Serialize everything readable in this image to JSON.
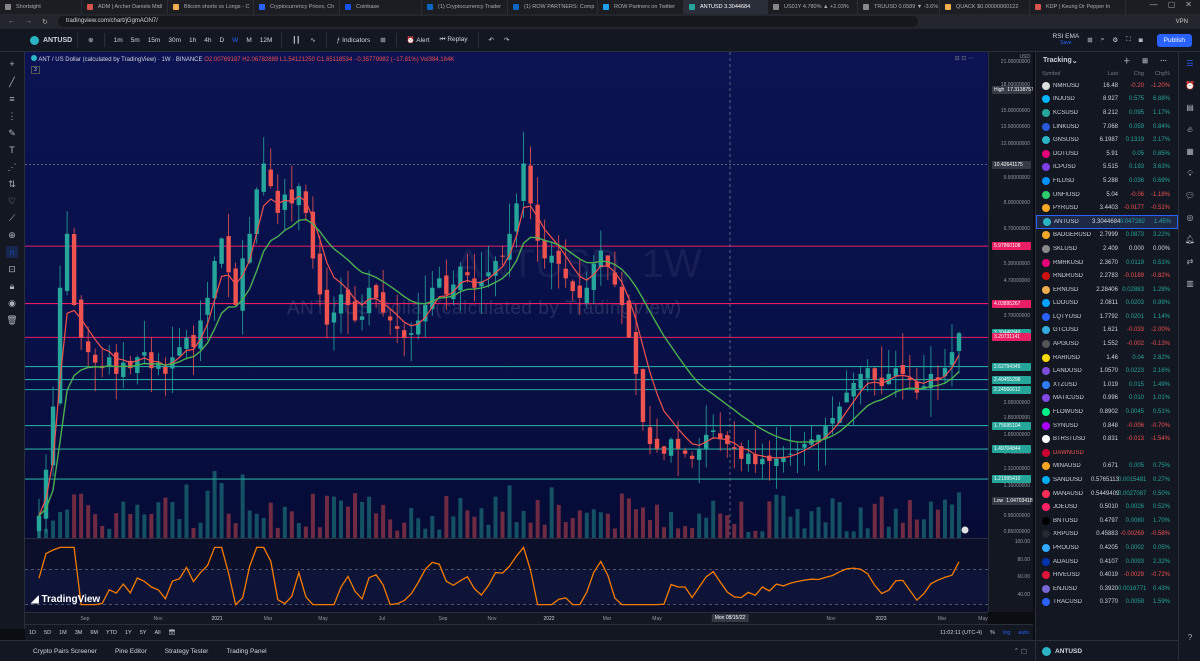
{
  "browser": {
    "tabs": [
      {
        "label": "Shortsight",
        "color": "#888"
      },
      {
        "label": "ADM | Archer Daniels Midl",
        "color": "#d9534f"
      },
      {
        "label": "Bitcoin shorts vs Longs - C",
        "color": "#f0ad4e"
      },
      {
        "label": "Cryptocurrency Prices, Ch",
        "color": "#2962ff"
      },
      {
        "label": "Coinbase",
        "color": "#1652f0"
      },
      {
        "label": "(1) Cryptocurrency Trader",
        "color": "#0a66c2"
      },
      {
        "label": "(1) ROW PARTNERS: Comp",
        "color": "#0a66c2"
      },
      {
        "label": "ROW Partners on Twitter",
        "color": "#1da1f2"
      },
      {
        "label": "ANTUSD 3.3044684",
        "color": "#26a69a",
        "active": true
      },
      {
        "label": "US01Y 4.780% ▲ +2.03%",
        "color": "#888"
      },
      {
        "label": "TRUUSD 0.0589 ▼ -3.6%",
        "color": "#888"
      },
      {
        "label": "QUACK $0.00000000122",
        "color": "#f0ad4e"
      },
      {
        "label": "KDP | Keurig Dr Pepper In",
        "color": "#d9534f"
      }
    ],
    "url": "tradingview.com/chart/jGgmAON7/",
    "vpn": "VPN"
  },
  "toolbar": {
    "symbol": "ANTUSD",
    "timeframes": [
      "1m",
      "5m",
      "15m",
      "30m",
      "1h",
      "4h",
      "D",
      "W",
      "M",
      "12M"
    ],
    "active_timeframe": "W",
    "indicators": "Indicators",
    "alert": "Alert",
    "replay": "Replay",
    "rsi_label": "RSI EMA",
    "rsi_sub": "Save",
    "publish": "Publish"
  },
  "legend": {
    "title": "ANT / US Dollar (calculated by TradingView) · 1W · BINANCE",
    "ohlc": "O2.00769187 H2.06782889 L1.54121250 C1.65118534 −0.35779982 (−17.81%) Vol384.184K",
    "count": "3"
  },
  "watermark": "ANT / US Dollar (calculated by TradingView)",
  "watermark_big": "ANTUSD, 1W",
  "price_axis": {
    "currency": "USD",
    "ticks": [
      "21.00000000",
      "18.00000000",
      "15.00000000",
      "13.50000000",
      "12.00000000",
      "9.50000000",
      "8.00000000",
      "6.70000000",
      "6.00000000",
      "5.30000000",
      "4.70000000",
      "3.70000000",
      "3.30000000",
      "2.60000000",
      "2.05000000",
      "1.85000000",
      "1.65000000",
      "1.46000000",
      "1.31000000",
      "1.16000000",
      "0.95000000",
      "0.85000000"
    ],
    "badges": [
      {
        "label": "High",
        "value": "17.31387571",
        "color": "#363a45"
      },
      {
        "label": "",
        "value": "10.42641175",
        "color": "#363a45"
      },
      {
        "label": "",
        "value": "5.97860108",
        "color": "#e91e63"
      },
      {
        "label": "",
        "value": "4.03895267",
        "color": "#e91e63"
      },
      {
        "label": "",
        "value": "3.30446849",
        "color": "#26a69a"
      },
      {
        "label": "",
        "value": "3.20731141",
        "color": "#e91e63"
      },
      {
        "label": "",
        "value": "2.62794345",
        "color": "#26a69a"
      },
      {
        "label": "",
        "value": "2.40455298",
        "color": "#26a69a"
      },
      {
        "label": "",
        "value": "2.24566612",
        "color": "#26a69a"
      },
      {
        "label": "",
        "value": "1.75695104",
        "color": "#26a69a"
      },
      {
        "label": "",
        "value": "1.49704844",
        "color": "#26a69a"
      },
      {
        "label": "",
        "value": "1.21995410",
        "color": "#26a69a"
      },
      {
        "label": "Low",
        "value": "1.04703418",
        "color": "#363a45"
      }
    ],
    "rsi_ticks": [
      "100.00",
      "80.00",
      "60.00",
      "40.00"
    ]
  },
  "time_axis": {
    "labels": [
      "Sep",
      "Nov",
      "2021",
      "Mar",
      "May",
      "Jul",
      "Sep",
      "Nov",
      "2022",
      "Mar",
      "May",
      "Jul",
      "Nov",
      "2023",
      "Mar",
      "May"
    ],
    "crosshair": "Mon 08/15/22"
  },
  "bottom": {
    "ranges": [
      "1D",
      "5D",
      "1M",
      "3M",
      "6M",
      "YTD",
      "1Y",
      "5Y",
      "All"
    ],
    "clock": "11:02:11 (UTC-4)",
    "pct": "%",
    "log": "log",
    "auto": "auto"
  },
  "panels": [
    "Crypto Pairs Screener",
    "Pine Editor",
    "Strategy Tester",
    "Trading Panel"
  ],
  "tv_logo": "TradingView",
  "watchlist": {
    "title": "Tracking",
    "columns": {
      "symbol": "Symbol",
      "last": "Last",
      "chg": "Chg",
      "pct": "Chg%"
    },
    "rows": [
      {
        "sym": "NMRUSD",
        "last": "16.48",
        "chg": "-0.20",
        "pct": "-1.20%",
        "dir": "dn",
        "color": "#ddd"
      },
      {
        "sym": "INJUSD",
        "last": "8.927",
        "chg": "0.575",
        "pct": "6.88%",
        "dir": "up",
        "color": "#00b2ff"
      },
      {
        "sym": "KCSUSD",
        "last": "8.212",
        "chg": "0.095",
        "pct": "1.17%",
        "dir": "up",
        "color": "#26a69a"
      },
      {
        "sym": "LINKUSD",
        "last": "7.068",
        "chg": "0.059",
        "pct": "0.84%",
        "dir": "up",
        "color": "#2a5ada"
      },
      {
        "sym": "GNSUSD",
        "last": "6.1987",
        "chg": "0.1319",
        "pct": "2.17%",
        "dir": "up",
        "color": "#2bb5c4"
      },
      {
        "sym": "DOTUSD",
        "last": "5.91",
        "chg": "0.05",
        "pct": "0.85%",
        "dir": "up",
        "color": "#e6007a"
      },
      {
        "sym": "ICPUSD",
        "last": "5.515",
        "chg": "0.193",
        "pct": "3.63%",
        "dir": "up",
        "color": "#7b3fe4"
      },
      {
        "sym": "FILUSD",
        "last": "5.288",
        "chg": "0.036",
        "pct": "0.69%",
        "dir": "up",
        "color": "#0090ff"
      },
      {
        "sym": "UNFIUSD",
        "last": "5.04",
        "chg": "-0.06",
        "pct": "-1.18%",
        "dir": "dn",
        "color": "#2ecc71"
      },
      {
        "sym": "PYRUSD",
        "last": "3.4403",
        "chg": "-0.0177",
        "pct": "-0.51%",
        "dir": "dn",
        "color": "#f5a623"
      },
      {
        "sym": "ANTUSD",
        "last": "3.3044684",
        "chg": "0.047282",
        "pct": "1.45%",
        "dir": "up",
        "color": "#2bb5c4",
        "sel": true
      },
      {
        "sym": "BADGERUSD",
        "last": "2.7999",
        "chg": "0.0873",
        "pct": "3.22%",
        "dir": "up",
        "color": "#f2a52b"
      },
      {
        "sym": "SKLUSD",
        "last": "2.409",
        "chg": "0.000",
        "pct": "0.00%",
        "dir": "flat",
        "color": "#888"
      },
      {
        "sym": "RMRKUSD",
        "last": "2.3670",
        "chg": "0.0119",
        "pct": "0.51%",
        "dir": "up",
        "color": "#e6007a"
      },
      {
        "sym": "RNDRUSD",
        "last": "2.2783",
        "chg": "-0.0189",
        "pct": "-0.82%",
        "dir": "dn",
        "color": "#cf1011"
      },
      {
        "sym": "ERNUSD",
        "last": "2.28406",
        "chg": "0.02883",
        "pct": "1.28%",
        "dir": "up",
        "color": "#f0ad4e"
      },
      {
        "sym": "LDOUSD",
        "last": "2.0811",
        "chg": "0.0203",
        "pct": "0.99%",
        "dir": "up",
        "color": "#00a3ff"
      },
      {
        "sym": "LQTYUSD",
        "last": "1.7792",
        "chg": "0.0201",
        "pct": "1.14%",
        "dir": "up",
        "color": "#2962ff"
      },
      {
        "sym": "GTCUSD",
        "last": "1.621",
        "chg": "-0.033",
        "pct": "-2.00%",
        "dir": "dn",
        "color": "#3ad"
      },
      {
        "sym": "API3USD",
        "last": "1.552",
        "chg": "-0.002",
        "pct": "-0.13%",
        "dir": "dn",
        "color": "#555"
      },
      {
        "sym": "RARIUSD",
        "last": "1.46",
        "chg": "0.04",
        "pct": "2.82%",
        "dir": "up",
        "color": "#feda03"
      },
      {
        "sym": "LANDUSD",
        "last": "1.0570",
        "chg": "0.0223",
        "pct": "2.16%",
        "dir": "up",
        "color": "#7d4cdb"
      },
      {
        "sym": "XTZUSD",
        "last": "1.019",
        "chg": "0.015",
        "pct": "1.49%",
        "dir": "up",
        "color": "#2c7df7"
      },
      {
        "sym": "MATICUSD",
        "last": "0.996",
        "chg": "0.010",
        "pct": "1.01%",
        "dir": "up",
        "color": "#8247e5"
      },
      {
        "sym": "FLOWUSD",
        "last": "0.8902",
        "chg": "0.0045",
        "pct": "0.51%",
        "dir": "up",
        "color": "#00ef8b"
      },
      {
        "sym": "SYNUSD",
        "last": "0.848",
        "chg": "-0.006",
        "pct": "-0.70%",
        "dir": "dn",
        "color": "#a0f"
      },
      {
        "sym": "BTRSTUSD",
        "last": "0.831",
        "chg": "-0.013",
        "pct": "-1.54%",
        "dir": "dn",
        "color": "#fff"
      },
      {
        "sym": "DAWNUSD",
        "last": "",
        "chg": "",
        "pct": "",
        "dir": "dn",
        "color": "#c03"
      },
      {
        "sym": "MINAUSD",
        "last": "0.671",
        "chg": "0.005",
        "pct": "0.75%",
        "dir": "up",
        "color": "#f5a623"
      },
      {
        "sym": "SANDUSD",
        "last": "0.5765113",
        "chg": "0.0015481",
        "pct": "0.27%",
        "dir": "up",
        "color": "#00adef"
      },
      {
        "sym": "MANAUSD",
        "last": "0.5449409",
        "chg": "0.0027067",
        "pct": "0.50%",
        "dir": "up",
        "color": "#ff2d55"
      },
      {
        "sym": "JOEUSD",
        "last": "0.5010",
        "chg": "0.0026",
        "pct": "0.52%",
        "dir": "up",
        "color": "#f26"
      },
      {
        "sym": "BNTUSD",
        "last": "0.4797",
        "chg": "0.0080",
        "pct": "1.70%",
        "dir": "up",
        "color": "#000"
      },
      {
        "sym": "XRPUSD",
        "last": "0.45883",
        "chg": "-0.00269",
        "pct": "-0.58%",
        "dir": "dn",
        "color": "#23292f"
      },
      {
        "sym": "PROUSD",
        "last": "0.4205",
        "chg": "0.0002",
        "pct": "0.05%",
        "dir": "up",
        "color": "#3af"
      },
      {
        "sym": "ADAUSD",
        "last": "0.4107",
        "chg": "0.0093",
        "pct": "2.32%",
        "dir": "up",
        "color": "#0033ad"
      },
      {
        "sym": "HIVEUSD",
        "last": "0.4019",
        "chg": "-0.0029",
        "pct": "-0.72%",
        "dir": "dn",
        "color": "#e31337"
      },
      {
        "sym": "ENJUSD",
        "last": "0.3920",
        "chg": "0.0016771",
        "pct": "0.43%",
        "dir": "up",
        "color": "#7866d5"
      },
      {
        "sym": "TRACUSD",
        "last": "0.3770",
        "chg": "0.0059",
        "pct": "1.59%",
        "dir": "up",
        "color": "#2962ff"
      }
    ],
    "footer": "ANTUSD"
  },
  "chart_data": {
    "type": "candlestick",
    "symbol": "ANTUSD",
    "interval": "1W",
    "exchange": "BINANCE",
    "y_scale": "log",
    "ylim": [
      0.85,
      21
    ],
    "x_range": [
      "2020-08",
      "2023-05"
    ],
    "horizontal_lines": [
      {
        "value": 10.42641175,
        "color": "#787b86",
        "style": "dotted"
      },
      {
        "value": 5.97860108,
        "color": "#e91e63"
      },
      {
        "value": 4.03895267,
        "color": "#e91e63"
      },
      {
        "value": 3.20731141,
        "color": "#e91e63"
      },
      {
        "value": 2.62794345,
        "color": "#26a69a"
      },
      {
        "value": 2.40455298,
        "color": "#26a69a"
      },
      {
        "value": 2.24566612,
        "color": "#26a69a"
      },
      {
        "value": 1.75695104,
        "color": "#26a69a"
      },
      {
        "value": 1.49704844,
        "color": "#26a69a"
      },
      {
        "value": 1.2199541,
        "color": "#26a69a"
      }
    ],
    "close_series": [
      0.95,
      1.3,
      2.0,
      4.5,
      6.5,
      4.0,
      3.2,
      2.9,
      2.7,
      2.6,
      2.8,
      2.5,
      2.7,
      2.6,
      2.8,
      2.9,
      2.6,
      2.7,
      2.5,
      2.8,
      3.0,
      3.2,
      3.0,
      3.6,
      4.2,
      5.4,
      6.3,
      5.0,
      4.0,
      5.5,
      6.5,
      8.8,
      10.5,
      9.0,
      7.5,
      8.5,
      8.0,
      9.0,
      7.5,
      5.5,
      4.3,
      3.5,
      3.8,
      4.3,
      4.0,
      3.6,
      3.7,
      4.5,
      4.2,
      3.8,
      3.6,
      3.4,
      3.2,
      3.3,
      3.6,
      4.0,
      4.5,
      4.8,
      4.3,
      4.6,
      5.2,
      4.9,
      4.5,
      4.7,
      5.0,
      5.4,
      5.6,
      6.5,
      8.0,
      10.5,
      8.0,
      6.2,
      5.5,
      5.6,
      5.3,
      4.8,
      4.4,
      4.2,
      4.5,
      5.3,
      5.8,
      5.2,
      4.6,
      4.0,
      3.2,
      2.5,
      1.8,
      1.55,
      1.5,
      1.45,
      1.6,
      1.5,
      1.45,
      1.4,
      1.5,
      1.65,
      1.7,
      1.6,
      1.55,
      1.5,
      1.4,
      1.45,
      1.35,
      1.4,
      1.38,
      1.4,
      1.42,
      1.45,
      1.5,
      1.55,
      1.6,
      1.65,
      1.75,
      1.85,
      2.0,
      2.2,
      2.35,
      2.5,
      2.6,
      2.4,
      2.3,
      2.5,
      2.6,
      2.5,
      2.4,
      2.2,
      2.3,
      2.5,
      2.4,
      2.6,
      2.9,
      3.3
    ],
    "ema_fast": "#ef5350",
    "ema_slow": "#4caf50",
    "rsi": {
      "name": "RSI EMA",
      "ticks": [
        40,
        60,
        80,
        100
      ]
    }
  }
}
